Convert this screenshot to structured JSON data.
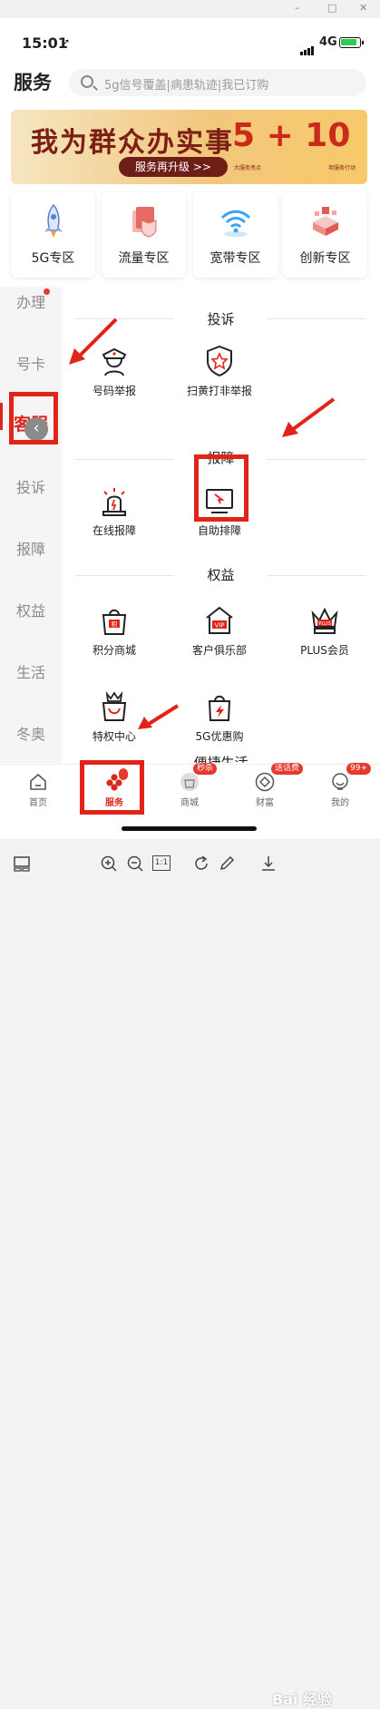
{
  "window": {
    "controls": [
      "–",
      "□",
      "✕"
    ]
  },
  "status_bar": {
    "time": "15:01",
    "network": "4G"
  },
  "header": {
    "title": "服务",
    "search_placeholder": "5g信号覆盖|病患轨迹|我已订购"
  },
  "banner": {
    "title": "我为群众办实事",
    "button": "服务再升级 >>",
    "number": "5 + 10",
    "caption_left": "大服务亮点",
    "caption_right": "项服务行动"
  },
  "zones": [
    {
      "label": "5G专区",
      "icon": "rocket-icon"
    },
    {
      "label": "流量专区",
      "icon": "shield-icon"
    },
    {
      "label": "宽带专区",
      "icon": "wifi-icon"
    },
    {
      "label": "创新专区",
      "icon": "cubes-icon"
    }
  ],
  "sidebar": {
    "items": [
      "办理",
      "号卡",
      "客服",
      "投诉",
      "报障",
      "权益",
      "生活",
      "冬奥"
    ],
    "active": "客服",
    "collapse_glyph": "‹"
  },
  "sections": [
    {
      "title": "投诉",
      "items": [
        {
          "label": "号码举报",
          "icon": "officer-icon"
        },
        {
          "label": "扫黄打非举报",
          "icon": "badge-star-icon"
        }
      ]
    },
    {
      "title": "报障",
      "items": [
        {
          "label": "在线报障",
          "icon": "warning-light-icon"
        },
        {
          "label": "自助排障",
          "icon": "monitor-cursor-icon"
        }
      ]
    },
    {
      "title": "权益",
      "items": [
        {
          "label": "积分商城",
          "icon": "points-bag-icon"
        },
        {
          "label": "客户俱乐部",
          "icon": "vip-house-icon"
        },
        {
          "label": "PLUS会员",
          "icon": "plus-crown-icon"
        },
        {
          "label": "特权中心",
          "icon": "crown-bag-icon"
        },
        {
          "label": "5G优惠购",
          "icon": "lightning-bag-icon"
        }
      ]
    },
    {
      "title": "便捷生活"
    }
  ],
  "tabbar": {
    "items": [
      {
        "label": "首页",
        "icon": "home-icon"
      },
      {
        "label": "服务",
        "icon": "flower-icon"
      },
      {
        "label": "商城",
        "icon": "bag-icon",
        "badge": "秒杀"
      },
      {
        "label": "财富",
        "icon": "diamond-icon",
        "badge": "送话费"
      },
      {
        "label": "我的",
        "icon": "face-icon",
        "badge": "99+"
      }
    ],
    "active": "服务"
  },
  "viewer": {
    "zoom_ratio": "1:1",
    "watermark": "Bai 经验"
  },
  "colors": {
    "accent": "#d9281f",
    "annotation": "#e2231a"
  }
}
